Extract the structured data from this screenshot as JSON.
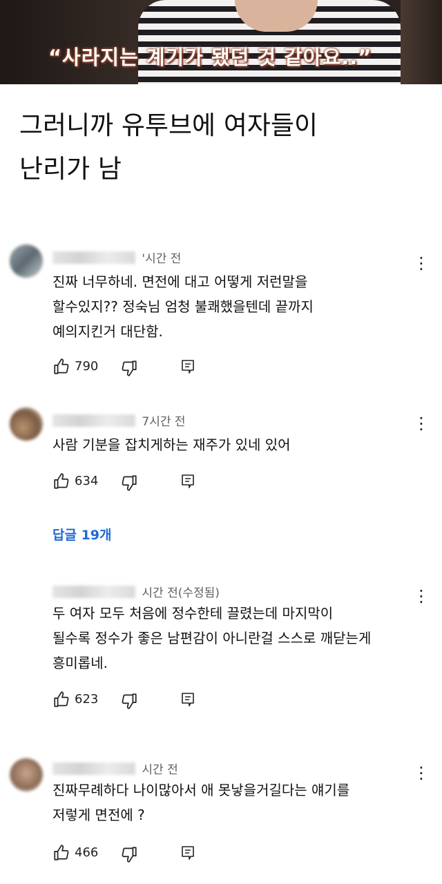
{
  "video": {
    "caption": "“사라지는 계기가 됐던 것 같아요..”"
  },
  "post": {
    "lines": [
      "그러니까 유투브에 여자들이",
      "난리가 남"
    ]
  },
  "comments": [
    {
      "timestamp": "'시간 전",
      "lines": [
        "진짜 너무하네. 면전에 대고 어떻게 저런말을",
        "할수있지?? 정숙님 엄청 불쾌했을텐데 끝까지",
        "예의지킨거 대단함."
      ],
      "likes": "790"
    },
    {
      "timestamp": "7시간 전",
      "lines": [
        "사람 기분을 잡치게하는 재주가 있네 있어"
      ],
      "likes": "634"
    },
    {
      "timestamp": "시간 전(수정됨)",
      "lines": [
        "두 여자 모두 처음에 정수한테 끌렸는데 마지막이",
        "될수록 정수가 좋은 남편감이 아니란걸 스스로 깨닫는게",
        "흥미롭네."
      ],
      "likes": "623"
    },
    {
      "timestamp": "시간 전",
      "lines": [
        "진짜무례하다 나이많아서 애 못낳을거길다는 얘기를",
        "저렇게 면전에 ?"
      ],
      "likes": "466"
    }
  ],
  "replies_link": "답글 19개",
  "icons": {
    "like": "thumbs-up-icon",
    "dislike": "thumbs-down-icon",
    "reply": "reply-icon",
    "menu": "more-vertical-icon"
  },
  "colors": {
    "link": "#1a6ad8",
    "meta": "#606060",
    "text": "#111111"
  }
}
